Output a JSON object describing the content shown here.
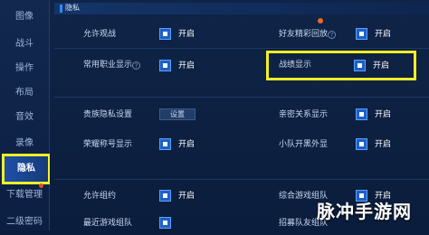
{
  "sidebar": {
    "items": [
      {
        "label": "图像"
      },
      {
        "label": "战斗"
      },
      {
        "label": "操作"
      },
      {
        "label": "布局"
      },
      {
        "label": "音效"
      },
      {
        "label": "录像"
      },
      {
        "label": "隐私"
      },
      {
        "label": "下载管理"
      },
      {
        "label": "二级密码"
      }
    ]
  },
  "section": {
    "title": "隐私"
  },
  "settings": {
    "allow_invite": "允许观战",
    "friend_history": "好友精彩回放",
    "common_role": "常用职业显示",
    "battle_display": "战绩显示",
    "noble_privacy": "贵族隐私设置",
    "settings_button": "设置",
    "intimate_display": "亲密关系显示",
    "honor_title": "荣耀称号显示",
    "team_appearance": "小队开黑外显",
    "allow_invite2": "允许组约",
    "comprehensive_team": "综合游戏组队",
    "recent_team": "最近游戏组队",
    "recruit_team": "招募队友组队"
  },
  "toggle_state": "开启",
  "watermark": "脉冲手游网"
}
